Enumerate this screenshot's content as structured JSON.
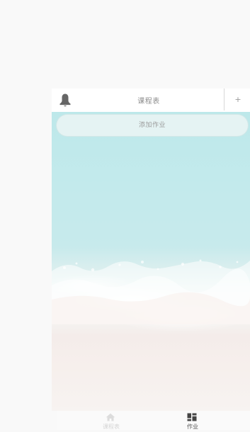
{
  "header": {
    "title": "课程表",
    "left_icon": "bell-icon",
    "right_action": "+"
  },
  "main": {
    "add_homework_label": "添加作业",
    "background": "beach-waves-image"
  },
  "bottom_nav": {
    "items": [
      {
        "label": "课程表",
        "icon": "home-icon",
        "active": false
      },
      {
        "label": "作业",
        "icon": "grid-icon",
        "active": true
      }
    ]
  },
  "colors": {
    "sea": "#bde8ea",
    "sand": "#f6efec",
    "active_text": "#555555",
    "inactive_text": "#d5d5d5"
  }
}
